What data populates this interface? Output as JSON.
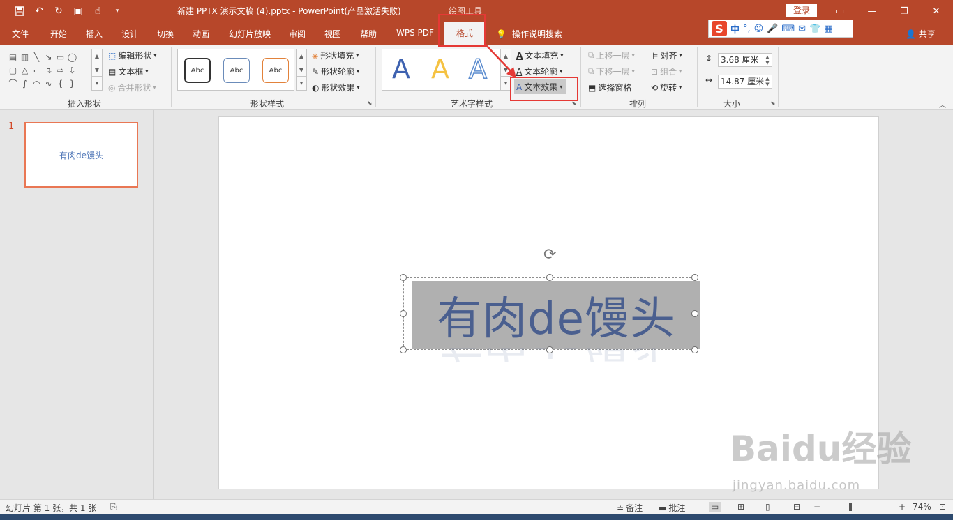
{
  "titlebar": {
    "document_title": "新建 PPTX 演示文稿 (4).pptx  -  PowerPoint(产品激活失败)",
    "context_label": "绘图工具",
    "login_label": "登录",
    "qat_icons": [
      "save-icon",
      "undo-icon",
      "redo-icon",
      "present-icon",
      "touch-icon",
      "customize-icon"
    ],
    "window_icons": [
      "ribbon-display-icon",
      "minimize-icon",
      "restore-icon",
      "close-icon"
    ]
  },
  "tabs": {
    "items": [
      "文件",
      "开始",
      "插入",
      "设计",
      "切换",
      "动画",
      "幻灯片放映",
      "审阅",
      "视图",
      "帮助",
      "WPS PDF"
    ],
    "active": "格式",
    "search_hint": "操作说明搜索",
    "share": "共享"
  },
  "ime": {
    "brand": "S",
    "mode": "中",
    "punct": "°,"
  },
  "ribbon": {
    "insert_shapes": {
      "label": "插入形状",
      "edit_shape": "编辑形状",
      "textbox": "文本框",
      "merge_shapes": "合并形状"
    },
    "shape_styles": {
      "label": "形状样式",
      "samples": [
        "Abc",
        "Abc",
        "Abc"
      ],
      "fill": "形状填充",
      "outline": "形状轮廓",
      "effects": "形状效果"
    },
    "wordart_styles": {
      "label": "艺术字样式",
      "samples": [
        "A",
        "A",
        "A"
      ],
      "text_fill": "文本填充",
      "text_outline": "文本轮廓",
      "text_effects": "文本效果"
    },
    "arrange": {
      "label": "排列",
      "bring_forward": "上移一层",
      "send_backward": "下移一层",
      "selection_pane": "选择窗格",
      "align": "对齐",
      "group": "组合",
      "rotate": "旋转"
    },
    "size": {
      "label": "大小",
      "height": "3.68 厘米",
      "width": "14.87 厘米"
    }
  },
  "thumbnails": [
    {
      "number": "1",
      "text": "有肉de馒头"
    }
  ],
  "slide": {
    "wordart_text": "有肉de馒头"
  },
  "watermark": {
    "logo": "Baidu经验",
    "url": "jingyan.baidu.com"
  },
  "statusbar": {
    "slide_info": "幻灯片 第 1 张，共 1 张",
    "notes": "备注",
    "comments": "批注",
    "zoom": "74%"
  },
  "colors": {
    "accent": "#b7472a",
    "highlight_box": "#e53935",
    "wordart_text": "#4a5f8f",
    "thumbnail_border": "#e97754"
  }
}
